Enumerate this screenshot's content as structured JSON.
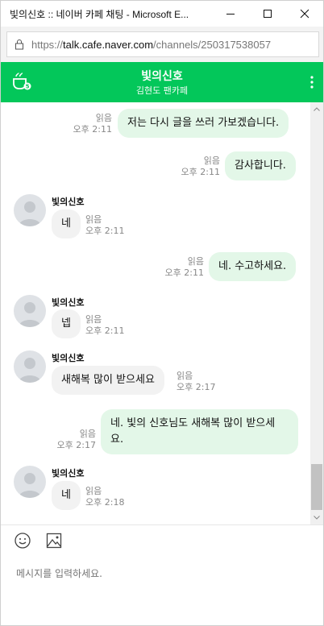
{
  "window": {
    "title": "빛의신호 :: 네이버 카페 채팅 - Microsoft E..."
  },
  "address": {
    "scheme": "https://",
    "host": "talk.cafe.naver.com",
    "path": "/channels/250317538057"
  },
  "header": {
    "channel_name": "빛의신호",
    "subtitle": "김현도 팬카페"
  },
  "messages": [
    {
      "text": "저는 다시 글을 쓰러 가보겠습니다.",
      "read": "읽음",
      "time": "오후 2:11"
    },
    {
      "text": "감사합니다.",
      "read": "읽음",
      "time": "오후 2:11"
    },
    {
      "sender": "빛의신호",
      "text": "네",
      "read": "읽음",
      "time": "오후 2:11"
    },
    {
      "text": "네. 수고하세요.",
      "read": "읽음",
      "time": "오후 2:11"
    },
    {
      "sender": "빛의신호",
      "text": "넵",
      "read": "읽음",
      "time": "오후 2:11"
    },
    {
      "sender": "빛의신호",
      "text": "새해복 많이 받으세요",
      "read": "읽음",
      "time": "오후 2:17"
    },
    {
      "text_line1": "네. 빛의 신호님도 새해복 많이 받으세",
      "text_line2": "요.",
      "read": "읽음",
      "time": "오후 2:17"
    },
    {
      "sender": "빛의신호",
      "text": "네",
      "read": "읽음",
      "time": "오후 2:18"
    }
  ],
  "composer": {
    "placeholder": "메시지를 입력하세요."
  },
  "colors": {
    "brand_green": "#03c75a",
    "my_bubble": "#e3f7e8",
    "their_bubble": "#f2f2f2"
  },
  "icons": [
    "lock-icon",
    "cafe-icon",
    "more-vertical-icon",
    "emoji-icon",
    "image-icon",
    "minimize-icon",
    "maximize-icon",
    "close-icon"
  ]
}
